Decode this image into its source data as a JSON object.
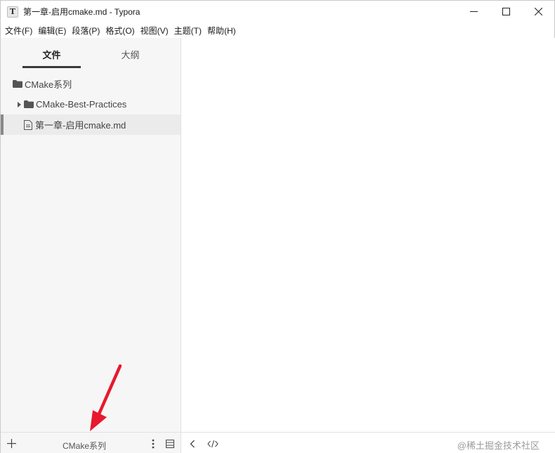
{
  "window": {
    "title": "第一章-启用cmake.md - Typora",
    "app_icon_letter": "T"
  },
  "menu": {
    "items": [
      "文件(F)",
      "编辑(E)",
      "段落(P)",
      "格式(O)",
      "视图(V)",
      "主题(T)",
      "帮助(H)"
    ]
  },
  "sidebar": {
    "tabs": {
      "files": "文件",
      "outline": "大纲"
    },
    "active_tab": "文件",
    "tree": {
      "root": "CMake系列",
      "subfolder": "CMake-Best-Practices",
      "selected_file": "第一章-启用cmake.md"
    }
  },
  "footer": {
    "folder_name": "CMake系列",
    "watermark": "@稀土掘金技术社区"
  },
  "icons": {
    "app": "typora-icon",
    "minimize": "minimize-icon",
    "maximize": "maximize-icon",
    "close": "close-icon",
    "folder": "folder-icon",
    "file": "file-icon",
    "expand": "triangle-right-icon",
    "add": "plus-icon",
    "more": "more-vertical-icon",
    "panel": "panel-icon",
    "back": "chevron-left-icon",
    "source": "code-icon"
  },
  "colors": {
    "annotation_arrow": "#e8192c",
    "sidebar_bg": "#f6f6f6",
    "selected_row": "#ebebeb"
  }
}
